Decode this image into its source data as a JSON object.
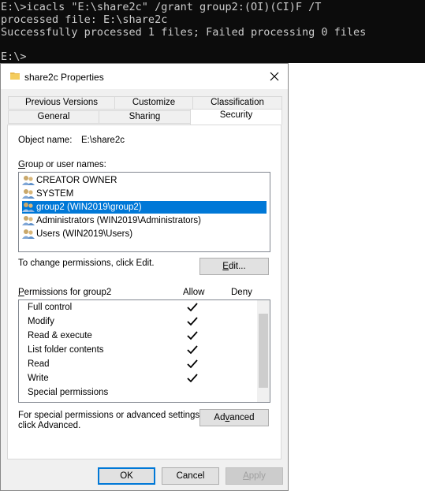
{
  "console": {
    "lines": [
      "E:\\>icacls \"E:\\share2c\" /grant group2:(OI)(CI)F /T",
      "processed file: E:\\share2c",
      "Successfully processed 1 files; Failed processing 0 files",
      "",
      "E:\\>"
    ]
  },
  "dialog": {
    "title": "share2c Properties",
    "tabs_row1": [
      "Previous Versions",
      "Customize",
      "Classification"
    ],
    "tabs_row2": [
      "General",
      "Sharing",
      "Security"
    ],
    "active_tab": "Security",
    "object_name_label": "Object name:",
    "object_name_value": "E:\\share2c",
    "group_label_prefix": "G",
    "group_label_rest": "roup or user names:",
    "users": [
      "CREATOR OWNER",
      "SYSTEM",
      "group2 (WIN2019\\group2)",
      "Administrators (WIN2019\\Administrators)",
      "Users (WIN2019\\Users)"
    ],
    "selected_user": "group2 (WIN2019\\group2)",
    "change_text": "To change permissions, click Edit.",
    "edit_button_prefix": "E",
    "edit_button_rest": "dit...",
    "permissions_label_prefix": "P",
    "permissions_label_rest": "ermissions for group2",
    "allow_header": "Allow",
    "deny_header": "Deny",
    "permissions": [
      {
        "name": "Full control",
        "allow": true
      },
      {
        "name": "Modify",
        "allow": true
      },
      {
        "name": "Read & execute",
        "allow": true
      },
      {
        "name": "List folder contents",
        "allow": true
      },
      {
        "name": "Read",
        "allow": true
      },
      {
        "name": "Write",
        "allow": true
      },
      {
        "name": "Special permissions",
        "allow": false
      }
    ],
    "special_text_line1": "For special permissions or advanced settings,",
    "special_text_line2": "click Advanced.",
    "advanced_button_prefix": "Ad",
    "advanced_button_underlined": "v",
    "advanced_button_rest": "anced",
    "ok_label": "OK",
    "cancel_label": "Cancel",
    "apply_prefix": "",
    "apply_underlined": "A",
    "apply_rest": "pply"
  },
  "colors": {
    "selection": "#0078d7",
    "console_bg": "#0c0c0c",
    "console_text": "#cccccc"
  }
}
